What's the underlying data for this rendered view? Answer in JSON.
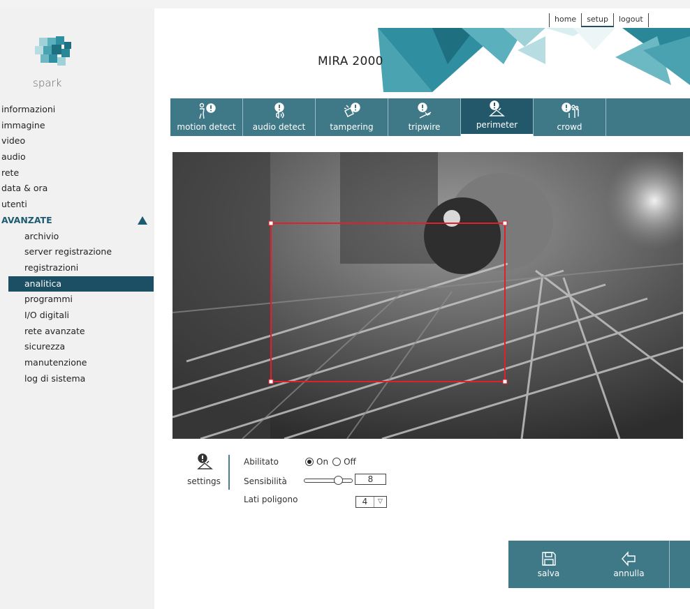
{
  "app": {
    "title": "MIRA 2000",
    "logo_text": "spark"
  },
  "topnav": {
    "items": [
      {
        "label": "home"
      },
      {
        "label": "setup",
        "active": true
      },
      {
        "label": "logout"
      }
    ]
  },
  "sidebar": {
    "items": [
      {
        "label": "informazioni"
      },
      {
        "label": "immagine"
      },
      {
        "label": "video"
      },
      {
        "label": "audio"
      },
      {
        "label": "rete"
      },
      {
        "label": "data & ora"
      },
      {
        "label": "utenti"
      }
    ],
    "group": {
      "label": "AVANZATE",
      "expanded_icon": "triangle-up-icon",
      "items": [
        {
          "label": "archivio"
        },
        {
          "label": "server registrazione"
        },
        {
          "label": "registrazioni"
        },
        {
          "label": "analitica",
          "active": true
        },
        {
          "label": "programmi"
        },
        {
          "label": "I/O digitali"
        },
        {
          "label": "rete avanzate"
        },
        {
          "label": "sicurezza"
        },
        {
          "label": "manutenzione"
        },
        {
          "label": "log di sistema"
        }
      ]
    }
  },
  "tabs": [
    {
      "label": "motion detect",
      "icon": "motion-detect-icon"
    },
    {
      "label": "audio detect",
      "icon": "audio-detect-icon"
    },
    {
      "label": "tampering",
      "icon": "tampering-icon"
    },
    {
      "label": "tripwire",
      "icon": "tripwire-icon"
    },
    {
      "label": "perimeter",
      "icon": "perimeter-icon",
      "active": true
    },
    {
      "label": "crowd",
      "icon": "crowd-icon"
    }
  ],
  "preview": {
    "polygon_color": "#e0202a"
  },
  "settings": {
    "label": "settings",
    "icon": "perimeter-icon",
    "enabled_label": "Abilitato",
    "on_label": "On",
    "off_label": "Off",
    "enabled_value": "On",
    "sensitivity_label": "Sensibilità",
    "sensitivity_value": "8",
    "polygon_sides_label": "Lati poligono",
    "polygon_sides_value": "4"
  },
  "actions": {
    "save_label": "salva",
    "cancel_label": "annulla"
  },
  "colors": {
    "accent": "#3f7886",
    "accent_dark": "#1c4f63"
  }
}
